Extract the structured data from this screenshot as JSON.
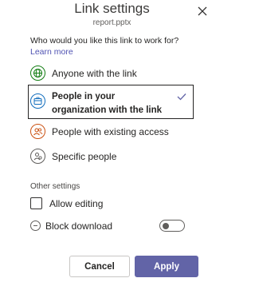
{
  "dialog": {
    "title": "Link settings",
    "filename": "report.pptx",
    "question": "Who would you like this link to work for?",
    "learn_more": "Learn more"
  },
  "options": [
    {
      "label": "Anyone with the link",
      "icon": "globe-icon",
      "selected": false
    },
    {
      "label": "People in your organization with the link",
      "icon": "building-icon",
      "selected": true
    },
    {
      "label": "People with existing access",
      "icon": "people-icon",
      "selected": false
    },
    {
      "label": "Specific people",
      "icon": "person-icon",
      "selected": false
    }
  ],
  "other_settings": {
    "heading": "Other settings",
    "allow_editing": {
      "label": "Allow editing",
      "checked": false
    },
    "block_download": {
      "label": "Block download",
      "enabled": false
    }
  },
  "buttons": {
    "cancel": "Cancel",
    "apply": "Apply"
  },
  "colors": {
    "accent": "#6264a7",
    "link": "#4f52b2",
    "globe": "#107c10",
    "org": "#0f6cbd",
    "existing": "#ca5010"
  }
}
